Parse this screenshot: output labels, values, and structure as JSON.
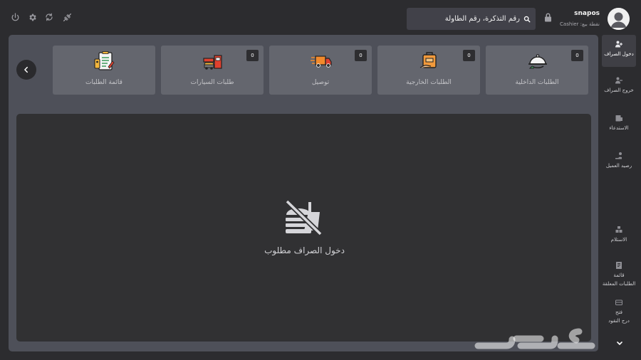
{
  "header": {
    "search_placeholder": "رقم التذكرة، رقم الطاولة",
    "user_name": "snapos",
    "user_position": "نقطة بيع: Cashier"
  },
  "cards": [
    {
      "label": "الطلبات الداخلية",
      "count": "0",
      "icon": "food-cloche-icon"
    },
    {
      "label": "الطلبات الخارجية",
      "count": "0",
      "icon": "takeaway-bag-icon"
    },
    {
      "label": "توصيل",
      "count": "0",
      "icon": "delivery-truck-icon"
    },
    {
      "label": "طلبات السيارات",
      "count": "0",
      "icon": "drive-thru-icon"
    },
    {
      "label": "قائمة الطلبات",
      "icon": "order-list-icon"
    }
  ],
  "empty_state": {
    "message": "دخول الصراف مطلوب",
    "icon": "no-food-icon"
  },
  "sidebar": {
    "items": [
      {
        "label": "دخول الصراف",
        "icon": "cashier-login-icon",
        "active": true
      },
      {
        "label": "خروج الصراف",
        "icon": "cashier-logout-icon"
      },
      {
        "label": "الاستدعاء",
        "icon": "recall-icon"
      },
      {
        "label": "رصيد العميل",
        "icon": "customer-balance-icon"
      },
      {
        "label": "الاستلام",
        "icon": "receiving-icon"
      },
      {
        "label_line1": "قائمة",
        "label_line2": "الطلبات المعلقة",
        "icon": "pending-orders-icon"
      },
      {
        "label_line1": "فتح",
        "label_line2": "درج النقود",
        "icon": "cash-drawer-icon"
      }
    ]
  },
  "toolbar_icons": [
    "power-icon",
    "settings-icon",
    "refresh-icon",
    "disconnect-icon"
  ],
  "watermark_text": "حراج",
  "colors": {
    "background": "#2c2c2f",
    "panel": "#4e5059",
    "card": "#64666e",
    "content": "#313133"
  }
}
